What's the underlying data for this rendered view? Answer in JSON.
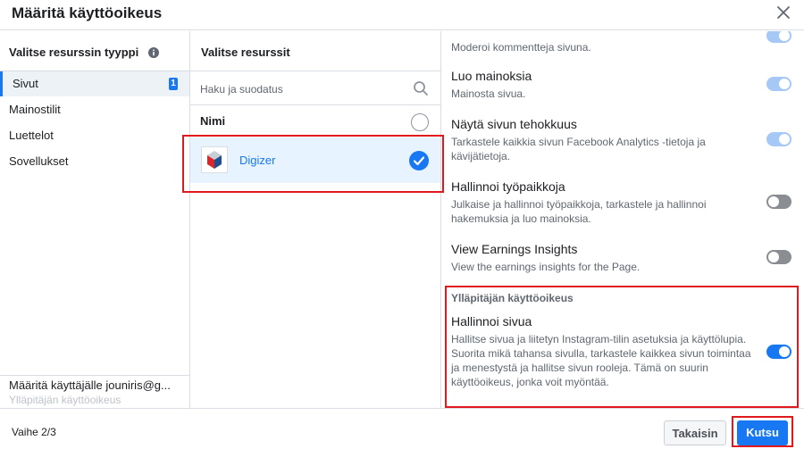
{
  "dialog": {
    "title": "Määritä käyttöoikeus",
    "close_icon": "close-icon"
  },
  "resource_types": {
    "title": "Valitse resurssin tyyppi",
    "info_icon": "info-icon",
    "items": [
      {
        "label": "Sivut",
        "badge": "1",
        "selected": true
      },
      {
        "label": "Mainostilit"
      },
      {
        "label": "Luettelot"
      },
      {
        "label": "Sovellukset"
      }
    ],
    "assign_text": "Määritä käyttäjälle jouniris@g...",
    "role_text": "Ylläpitäjän käyttöoikeus"
  },
  "resources": {
    "title": "Valitse resurssit",
    "search_placeholder": "Haku ja suodatus",
    "name_header": "Nimi",
    "pages": [
      {
        "name": "Digizer",
        "selected": true
      }
    ]
  },
  "permissions": {
    "items": [
      {
        "title": "",
        "description": "Moderoi kommentteja sivuna.",
        "toggle": "on-dim"
      },
      {
        "title": "Luo mainoksia",
        "description": "Mainosta sivua.",
        "toggle": "on-dim"
      },
      {
        "title": "Näytä sivun tehokkuus",
        "description": "Tarkastele kaikkia sivun Facebook Analytics -tietoja ja kävijätietoja.",
        "toggle": "on-dim"
      },
      {
        "title": "Hallinnoi työpaikkoja",
        "description": "Julkaise ja hallinnoi työpaikkoja, tarkastele ja hallinnoi hakemuksia ja luo mainoksia.",
        "toggle": "off"
      },
      {
        "title": "View Earnings Insights",
        "description": "View the earnings insights for the Page.",
        "toggle": "off"
      }
    ],
    "admin_section": {
      "heading": "Ylläpitäjän käyttöoikeus",
      "title": "Hallinnoi sivua",
      "description": "Hallitse sivua ja liitetyn Instagram-tilin asetuksia ja käyttölupia. Suorita mikä tahansa sivulla, tarkastele kaikkea sivun toimintaa ja menestystä ja hallitse sivun rooleja. Tämä on suurin käyttöoikeus, jonka voit myöntää.",
      "toggle": "on"
    }
  },
  "footer": {
    "step": "Vaihe 2/3",
    "back_label": "Takaisin",
    "invite_label": "Kutsu"
  },
  "colors": {
    "accent": "#1877f2",
    "highlight_box": "#e0191f",
    "selected_row": "#e7f3ff"
  }
}
